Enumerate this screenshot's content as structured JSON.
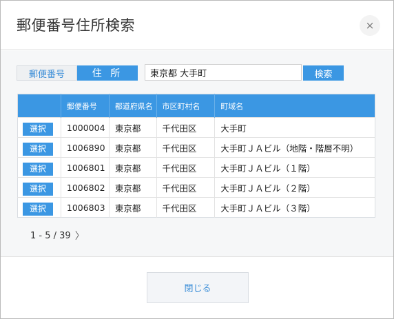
{
  "dialog": {
    "title": "郵便番号住所検索",
    "close_icon": "×"
  },
  "search": {
    "tab_postal": "郵便番号",
    "tab_address": "住 所",
    "input_value": "東京都 大手町",
    "button_label": "検索"
  },
  "table": {
    "headers": [
      "",
      "郵便番号",
      "都道府県名",
      "市区町村名",
      "町域名"
    ],
    "select_label": "選択",
    "rows": [
      [
        "1000004",
        "東京都",
        "千代田区",
        "大手町"
      ],
      [
        "1006890",
        "東京都",
        "千代田区",
        "大手町ＪＡビル（地階・階層不明）"
      ],
      [
        "1006801",
        "東京都",
        "千代田区",
        "大手町ＪＡビル（１階）"
      ],
      [
        "1006802",
        "東京都",
        "千代田区",
        "大手町ＪＡビル（２階）"
      ],
      [
        "1006803",
        "東京都",
        "千代田区",
        "大手町ＪＡビル（３階）"
      ]
    ]
  },
  "pager": {
    "range": "1 - 5 / 39",
    "next_icon": "〉"
  },
  "footer": {
    "close_label": "閉じる"
  },
  "colors": {
    "accent": "#3b97e3",
    "body_bg": "#f6f7f8"
  }
}
